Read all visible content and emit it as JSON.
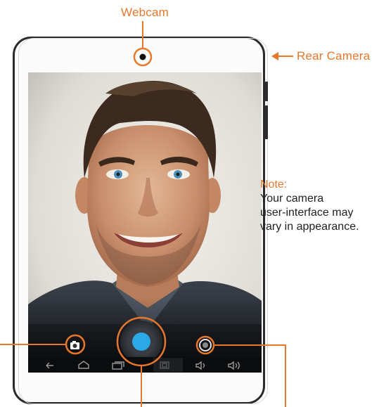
{
  "labels": {
    "webcam": "Webcam",
    "rear_camera": "Rear Camera"
  },
  "note": {
    "heading": "Note:",
    "line1": "Your camera",
    "line2": "user-interface may",
    "line3": "vary in appearance."
  },
  "colors": {
    "accent": "#e9772b",
    "shutter": "#2aa9e6",
    "frame": "#2b2b2b"
  },
  "icons": {
    "mode_switch": "camera-icon",
    "settings": "settings-ring-icon",
    "shutter": "shutter-button",
    "nav_back": "back-arrow-icon",
    "nav_home": "home-icon",
    "nav_recents": "recents-icon",
    "nav_screenshot": "screenshot-icon",
    "vol_down": "volume-down-icon",
    "vol_up": "volume-up-icon"
  }
}
